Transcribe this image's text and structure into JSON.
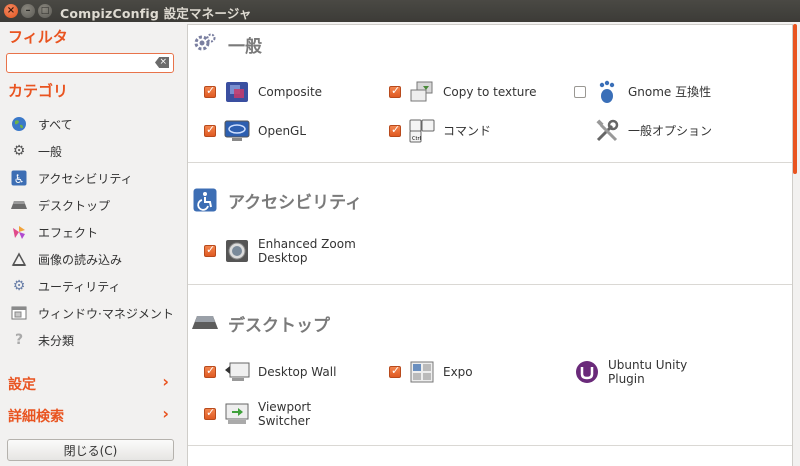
{
  "window": {
    "title": "CompizConfig 設定マネージャ",
    "close": "×",
    "minimize": "–",
    "maximize": "□"
  },
  "sidebar": {
    "filter_label": "フィルタ",
    "filter_value": "",
    "category_label": "カテゴリ",
    "categories": [
      {
        "label": "すべて",
        "icon": "globe-icon"
      },
      {
        "label": "一般",
        "icon": "gears-icon"
      },
      {
        "label": "アクセシビリティ",
        "icon": "accessibility-icon"
      },
      {
        "label": "デスクトップ",
        "icon": "desktop-icon"
      },
      {
        "label": "エフェクト",
        "icon": "effects-icon"
      },
      {
        "label": "画像の読み込み",
        "icon": "image-loading-icon"
      },
      {
        "label": "ユーティリティ",
        "icon": "utility-icon"
      },
      {
        "label": "ウィンドウ·マネジメント",
        "icon": "window-management-icon"
      },
      {
        "label": "未分類",
        "icon": "uncategorized-icon"
      }
    ],
    "settings_label": "設定",
    "advanced_search_label": "詳細検索",
    "chevron": "›",
    "close_button": "閉じる(C)"
  },
  "main": {
    "sections": [
      {
        "title": "一般",
        "icon": "gears-icon",
        "plugins": [
          {
            "label": "Composite",
            "checked": true,
            "icon": "composite-icon"
          },
          {
            "label": "Copy to texture",
            "checked": true,
            "icon": "copy-to-texture-icon"
          },
          {
            "label": "Gnome 互換性",
            "checked": false,
            "icon": "gnome-foot-icon"
          },
          {
            "label": "OpenGL",
            "checked": true,
            "icon": "opengl-icon"
          },
          {
            "label": "コマンド",
            "checked": true,
            "icon": "keyboard-command-icon"
          },
          {
            "label": "一般オプション",
            "checked": false,
            "icon": "tools-icon"
          }
        ]
      },
      {
        "title": "アクセシビリティ",
        "icon": "accessibility-icon",
        "plugins": [
          {
            "label_line1": "Enhanced Zoom",
            "label_line2": "Desktop",
            "checked": true,
            "icon": "zoom-icon"
          }
        ]
      },
      {
        "title": "デスクトップ",
        "icon": "desktop-icon",
        "plugins": [
          {
            "label": "Desktop Wall",
            "checked": true,
            "icon": "desktop-wall-icon"
          },
          {
            "label": "Expo",
            "checked": true,
            "icon": "expo-icon"
          },
          {
            "label_line1": "Ubuntu Unity",
            "label_line2": "Plugin",
            "checked": false,
            "icon": "ubuntu-unity-icon"
          },
          {
            "label_line1": "Viewport",
            "label_line2": "Switcher",
            "checked": true,
            "icon": "viewport-switcher-icon"
          }
        ]
      }
    ]
  },
  "colors": {
    "accent": "#e95420",
    "title_bar": "#3c3b37"
  }
}
